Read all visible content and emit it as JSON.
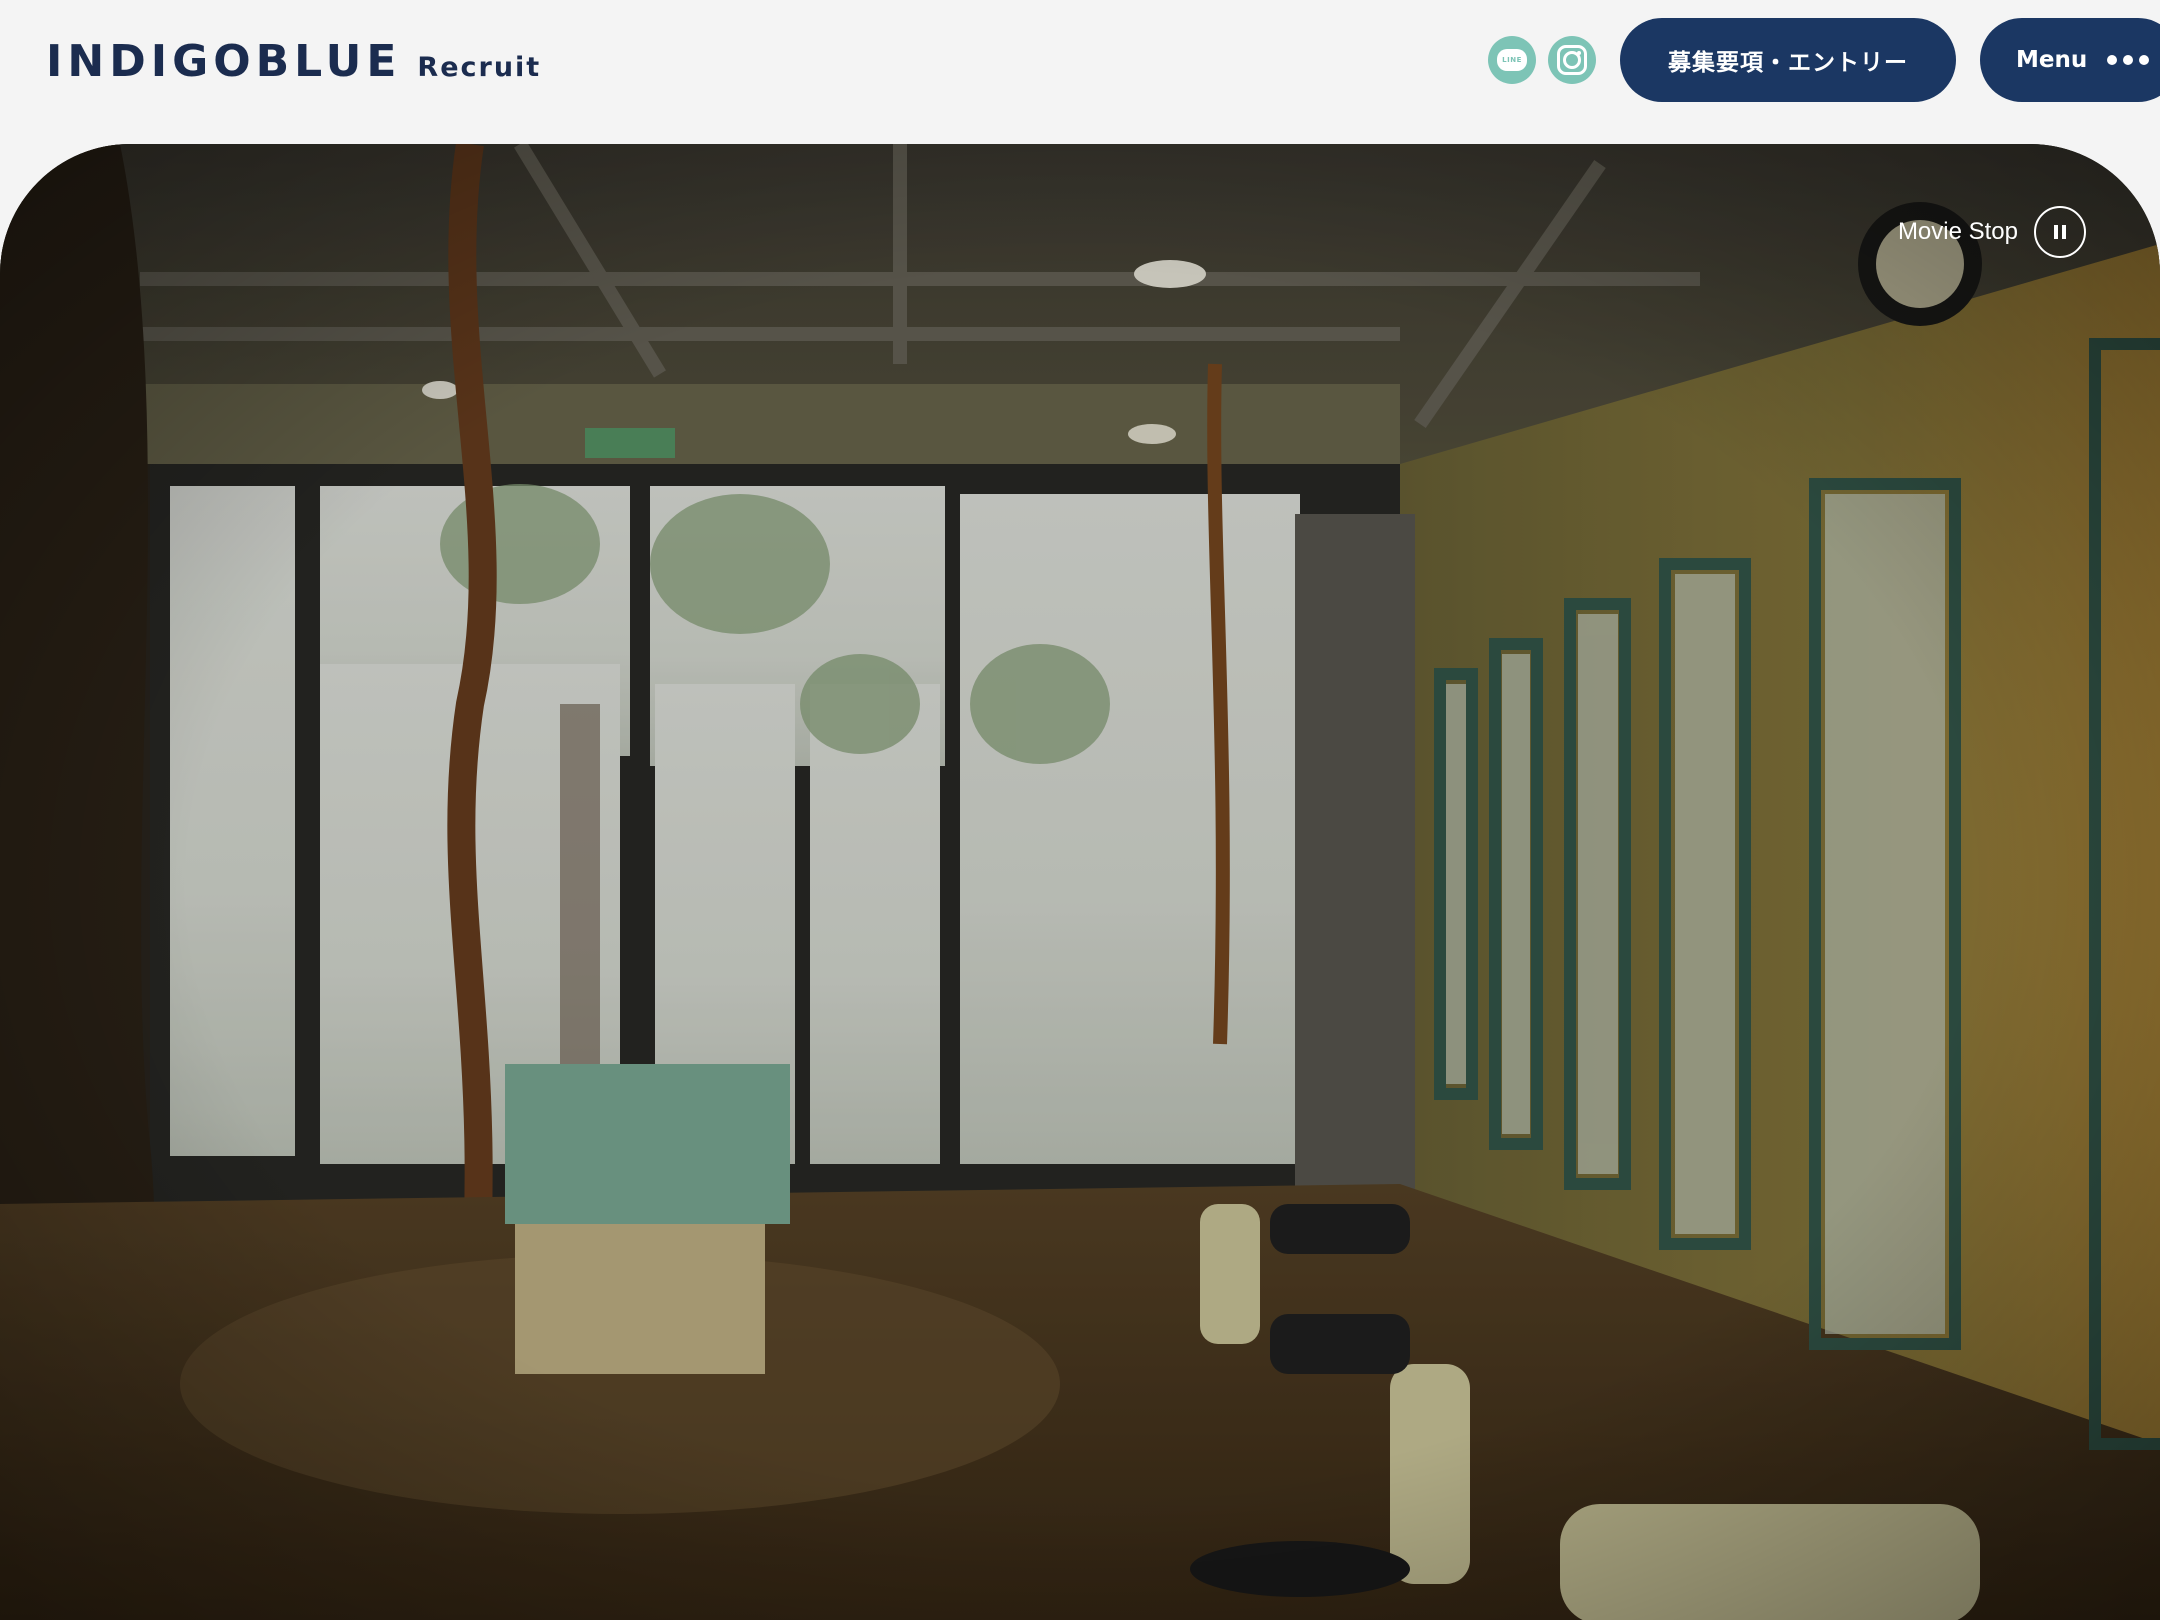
{
  "header": {
    "logo_main": "INDIGOBLUE",
    "logo_sub": "Recruit",
    "line_icon_text": "LINE",
    "entry_button": "募集要項・エントリー",
    "menu_button": "Menu"
  },
  "hero": {
    "movie_toggle_label": "Movie Stop"
  },
  "colors": {
    "navy": "#1b3763",
    "logo": "#1b2c4f",
    "teal_icon": "#7dc4b6",
    "background": "#f4f4f4"
  },
  "icons": {
    "line": "line-icon",
    "instagram": "instagram-icon",
    "menu_dots": "more-dots-icon",
    "pause": "pause-icon"
  }
}
